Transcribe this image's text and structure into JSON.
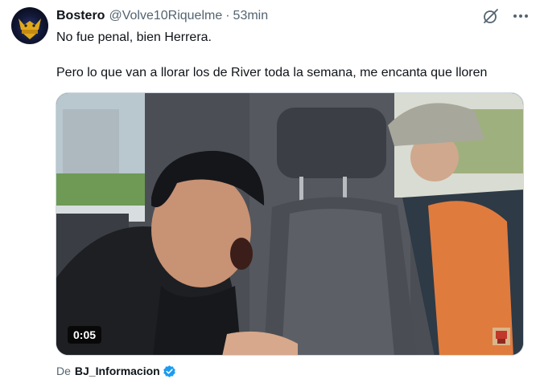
{
  "tweet": {
    "display_name": "Bostero",
    "handle": "@Volve10Riquelme",
    "separator": "·",
    "time": "53min",
    "text": "No fue penal, bien Herrera.\n\nPero lo que van a llorar los de River toda la semana, me encanta que lloren",
    "video_duration": "0:05",
    "source_prefix": "De",
    "source_account": "BJ_Informacion"
  },
  "icons": {
    "grok": "grok-icon",
    "more": "more-options-icon",
    "verified": "verified-badge-icon"
  },
  "colors": {
    "text_primary": "#0f1419",
    "text_secondary": "#536471",
    "verified_blue": "#1d9bf0"
  }
}
